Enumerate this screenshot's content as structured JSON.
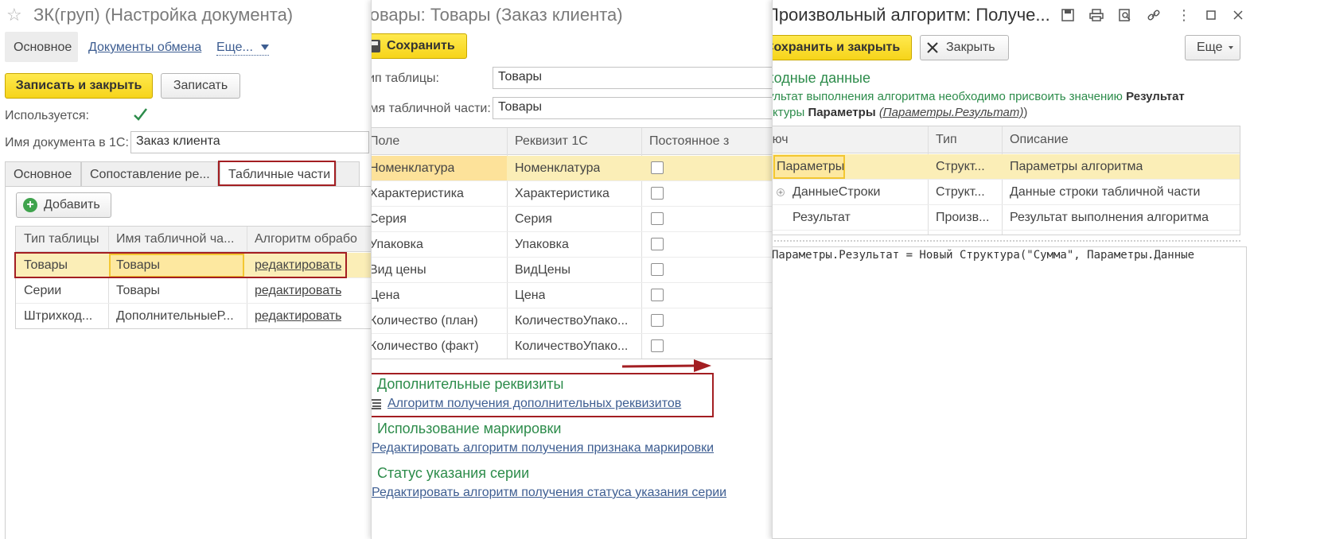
{
  "w1": {
    "title": "ЗК(груп) (Настройка документа)",
    "nav": {
      "main": "Основное",
      "exchange_docs": "Документы обмена",
      "more": "Еще..."
    },
    "toolbar": {
      "save_close": "Записать и закрыть",
      "save": "Записать"
    },
    "used_label": "Используется:",
    "doc_name_label": "Имя документа в 1С:",
    "doc_name_value": "Заказ клиента",
    "tabs": [
      "Основное",
      "Сопоставление ре...",
      "Табличные части"
    ],
    "add_label": "Добавить",
    "table": {
      "headers": [
        "Тип таблицы",
        "Имя табличной ча...",
        "Алгоритм обрабо"
      ],
      "rows": [
        {
          "type": "Товары",
          "name": "Товары",
          "algo": "редактировать"
        },
        {
          "type": "Серии",
          "name": "Товары",
          "algo": "редактировать"
        },
        {
          "type": "Штрихкод...",
          "name": "ДополнительныеР...",
          "algo": "редактировать"
        }
      ]
    }
  },
  "w2": {
    "title": "Товары: Товары (Заказ клиента)",
    "save": "Сохранить",
    "table_type_label": "Тип таблицы:",
    "table_type_value": "Товары",
    "part_name_label": "Имя табличной части:",
    "part_name_value": "Товары",
    "grid": {
      "headers": [
        "Поле",
        "Реквизит 1С",
        "Постоянное з"
      ],
      "rows": [
        {
          "field": "Номенклатура",
          "attr": "Номенклатура"
        },
        {
          "field": "Характеристика",
          "attr": "Характеристика"
        },
        {
          "field": "Серия",
          "attr": "Серия"
        },
        {
          "field": "Упаковка",
          "attr": "Упаковка"
        },
        {
          "field": "Вид цены",
          "attr": "ВидЦены"
        },
        {
          "field": "Цена",
          "attr": "Цена"
        },
        {
          "field": "Количество (план)",
          "attr": "КоличествоУпако..."
        },
        {
          "field": "Количество (факт)",
          "attr": "КоличествоУпако..."
        }
      ]
    },
    "sections": [
      {
        "title": "Дополнительные реквизиты",
        "link": "Алгоритм получения дополнительных реквизитов"
      },
      {
        "title": "Использование маркировки",
        "link": "Редактировать алгоритм получения признака маркировки"
      },
      {
        "title": "Статус указания серии",
        "link": "Редактировать алгоритм получения статуса указания серии"
      }
    ]
  },
  "w3": {
    "title": "Произвольный алгоритм: Получе...",
    "save_close": "Сохранить и закрыть",
    "close": "Закрыть",
    "more": "Еще",
    "section_title": "Входные данные",
    "hint_line1_a": "Результат выполнения алгоритма необходимо присвоить значению ",
    "hint_line1_b": "Результат",
    "hint_line2_a": "структуры ",
    "hint_line2_b": "Параметры",
    "hint_line2_c": "(Параметры.Результат)",
    "hint_paren_close": ")",
    "grid": {
      "headers": [
        "Ключ",
        "Тип",
        "Описание"
      ],
      "rows": [
        {
          "key": "Параметры",
          "type": "Структ...",
          "desc": "Параметры алгоритма"
        },
        {
          "key": "ДанныеСтроки",
          "type": "Структ...",
          "desc": "Данные строки табличной части"
        },
        {
          "key": "Результат",
          "type": "Произв...",
          "desc": "Результат выполнения алгоритма"
        }
      ]
    },
    "code": "Параметры.Результат = Новый Структура(\"Сумма\", Параметры.Данные"
  },
  "colors": {
    "accent_yellow": "#f6d41a",
    "selection": "#fbeeb7",
    "link": "#3d5d91",
    "section_green": "#2d8c4b",
    "highlight_red": "#a31e22"
  }
}
